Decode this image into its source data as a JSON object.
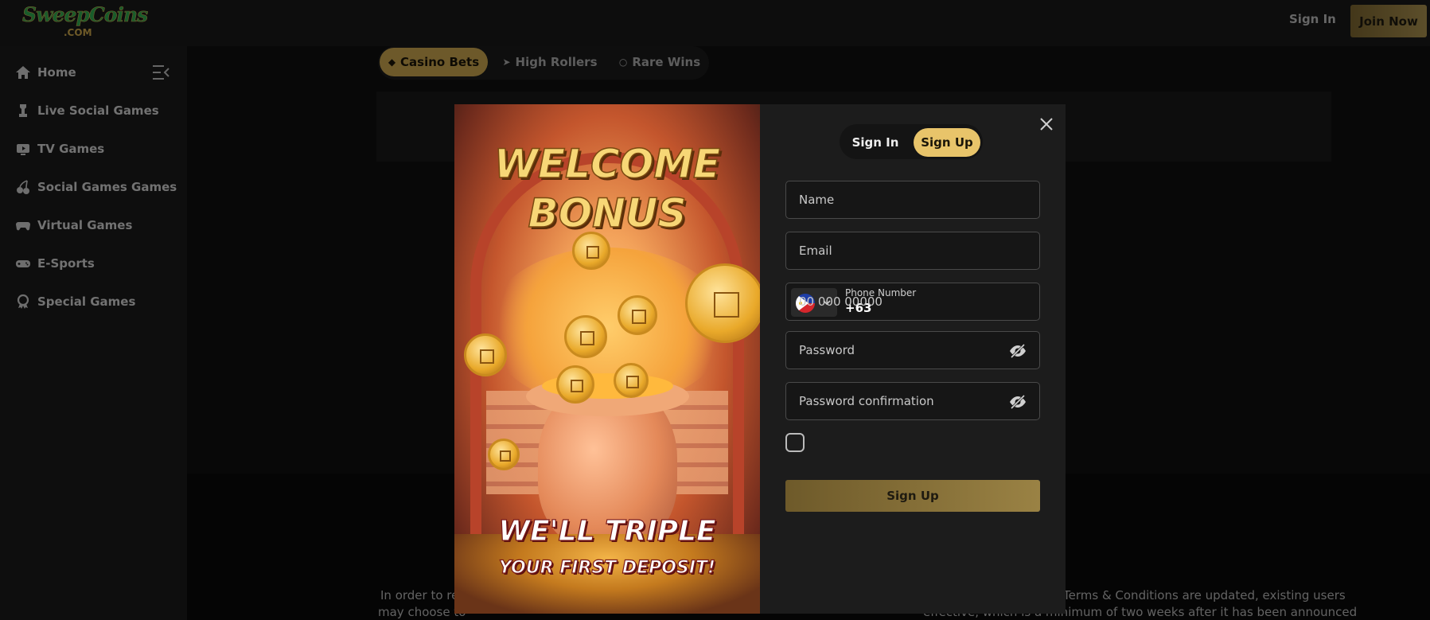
{
  "header": {
    "logo_main": "SweepCoins",
    "logo_sub": ".COM",
    "sign_in_label": "Sign In",
    "join_now_label": "Join Now"
  },
  "sidebar": {
    "items": [
      {
        "label": "Home",
        "icon": "home-icon"
      },
      {
        "label": "Live Social Games",
        "icon": "chess-icon"
      },
      {
        "label": "TV Games",
        "icon": "tv-icon"
      },
      {
        "label": "Social Games Games",
        "icon": "cherries-icon"
      },
      {
        "label": "Virtual Games",
        "icon": "gamepad-icon"
      },
      {
        "label": "E-Sports",
        "icon": "controller-icon"
      },
      {
        "label": "Special Games",
        "icon": "special-icon"
      }
    ]
  },
  "main": {
    "tabs": [
      {
        "label": "Casino Bets",
        "active": true
      },
      {
        "label": "High Rollers",
        "active": false
      },
      {
        "label": "Rare Wins",
        "active": false
      }
    ],
    "footer_left_1": "In order to reg",
    "footer_left_2": "may choose to",
    "footer_right_1": "Terms & Conditions are updated, existing users",
    "footer_right_2": "effective, which is a minimum of two weeks after it has been announced"
  },
  "modal": {
    "promo": {
      "line1": "WELCOME",
      "line2": "BONUS",
      "line3": "WE'LL TRIPLE",
      "line4": "YOUR FIRST DEPOSIT!"
    },
    "switch": {
      "sign_in": "Sign In",
      "sign_up": "Sign Up",
      "active": "Sign Up"
    },
    "fields": {
      "name_placeholder": "Name",
      "email_placeholder": "Email",
      "phone_label": "Phone Number",
      "phone_code": "+63",
      "phone_placeholder": "00 000 00000",
      "password_placeholder": "Password",
      "password_confirm_placeholder": "Password confirmation"
    },
    "terms_checked": false,
    "submit_label": "Sign Up"
  },
  "colors": {
    "accent_gold": "#c7a24e",
    "switch_gold": "#e8c46a",
    "background": "#111111",
    "sidebar": "#1a1a1a"
  }
}
